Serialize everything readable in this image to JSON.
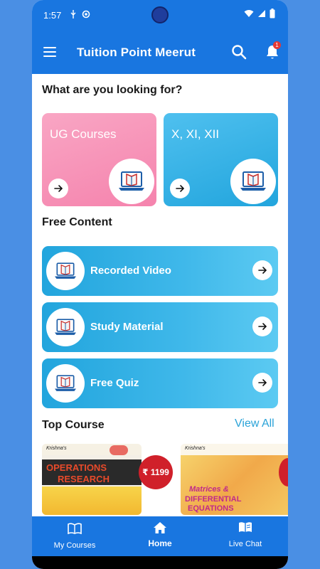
{
  "status_bar": {
    "time": "1:57"
  },
  "app_bar": {
    "title": "Tuition Point Meerut",
    "notification_count": "1"
  },
  "sections": {
    "looking_for": "What are you looking for?",
    "free_content": "Free Content",
    "top_course": "Top Course",
    "view_all": "View All"
  },
  "categories": [
    {
      "label": "UG Courses",
      "color": "#f794b8"
    },
    {
      "label": "X, XI, XII",
      "color": "#3cb6ea"
    }
  ],
  "free_content": [
    {
      "label": "Recorded Video"
    },
    {
      "label": "Study Material"
    },
    {
      "label": "Free Quiz"
    }
  ],
  "top_courses": [
    {
      "book_series": "Krishna's",
      "title_line1": "OPERATIONS",
      "title_line2": "RESEARCH",
      "price": "₹ 1199"
    },
    {
      "book_series": "Krishna's",
      "title_line1": "Matrices &",
      "title_line2": "DIFFERENTIAL",
      "title_line3": "EQUATIONS"
    }
  ],
  "bottom_nav": [
    {
      "label": "My Courses",
      "icon": "book-open-icon"
    },
    {
      "label": "Home",
      "icon": "home-icon",
      "active": true
    },
    {
      "label": "Live Chat",
      "icon": "book-chat-icon"
    }
  ],
  "colors": {
    "primary": "#1976e0",
    "accent_blue": "#3cb6ea",
    "pink": "#f794b8",
    "price_red": "#d0202a"
  }
}
